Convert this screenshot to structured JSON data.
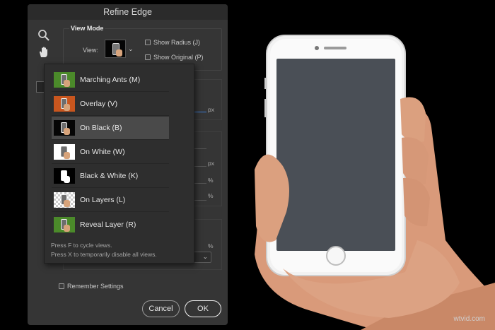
{
  "dialog": {
    "title": "Refine Edge",
    "view_mode": {
      "section_title": "View Mode",
      "view_label": "View:",
      "show_radius": "Show Radius (J)",
      "show_original": "Show Original (P)"
    },
    "menu": {
      "items": [
        {
          "label": "Marching Ants (M)",
          "thumb_bg": "#4b8a2a",
          "selected": false
        },
        {
          "label": "Overlay (V)",
          "thumb_bg": "#c9561e",
          "selected": false
        },
        {
          "label": "On Black (B)",
          "thumb_bg": "#050505",
          "selected": true
        },
        {
          "label": "On White (W)",
          "thumb_bg": "#ffffff",
          "selected": false
        },
        {
          "label": "Black & White (K)",
          "thumb_bg": "#000000",
          "selected": false
        },
        {
          "label": "On Layers (L)",
          "thumb_bg": "checker",
          "selected": false
        },
        {
          "label": "Reveal Layer (R)",
          "thumb_bg": "#4b8a2a",
          "selected": false
        }
      ],
      "hint_cycle": "Press F to cycle views.",
      "hint_disable": "Press X to temporarily disable all views."
    },
    "background_units": {
      "px1": "px",
      "px2": "px",
      "pct1": "%",
      "pct2": "%",
      "pct3": "%"
    },
    "remember_settings": "Remember Settings",
    "cancel_label": "Cancel",
    "ok_label": "OK"
  },
  "photo": {
    "watermark": "wtvid.com"
  },
  "colors": {
    "dialog_bg": "#353535",
    "titlebar_bg": "#2b2b2b",
    "menu_bg": "#2e2e2e",
    "selected_bg": "#4a4a4a",
    "accent_blue": "#3d7bd3"
  }
}
